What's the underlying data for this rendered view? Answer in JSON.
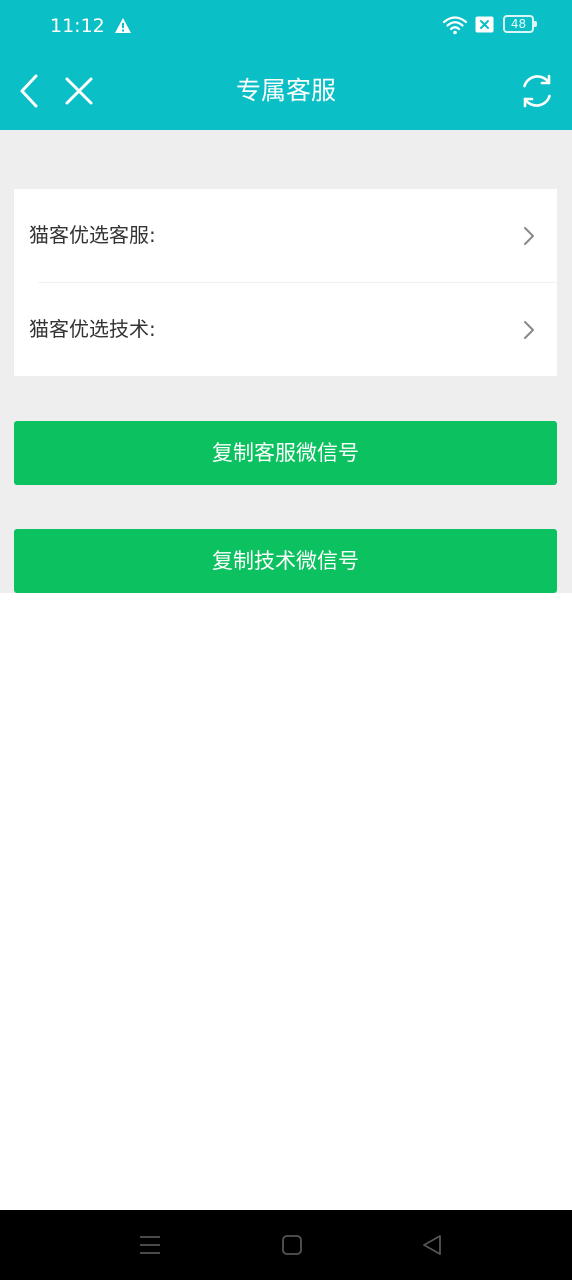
{
  "status_bar": {
    "time": "11:12",
    "battery": "48",
    "icons": [
      "alert-icon",
      "wifi-icon",
      "signal-off-icon",
      "battery-icon"
    ]
  },
  "header": {
    "title": "专属客服",
    "icons": [
      "back-icon",
      "close-icon",
      "refresh-icon"
    ],
    "background_color": "#0bbfc6"
  },
  "list": {
    "items": [
      {
        "label": "猫客优选客服:"
      },
      {
        "label": "猫客优选技术:"
      }
    ]
  },
  "buttons": {
    "copy_service_wechat": "复制客服微信号",
    "copy_tech_wechat": "复制技术微信号",
    "color": "#0cc160"
  },
  "system_nav": {
    "icons": [
      "menu-icon",
      "home-icon",
      "back-triangle-icon"
    ]
  }
}
